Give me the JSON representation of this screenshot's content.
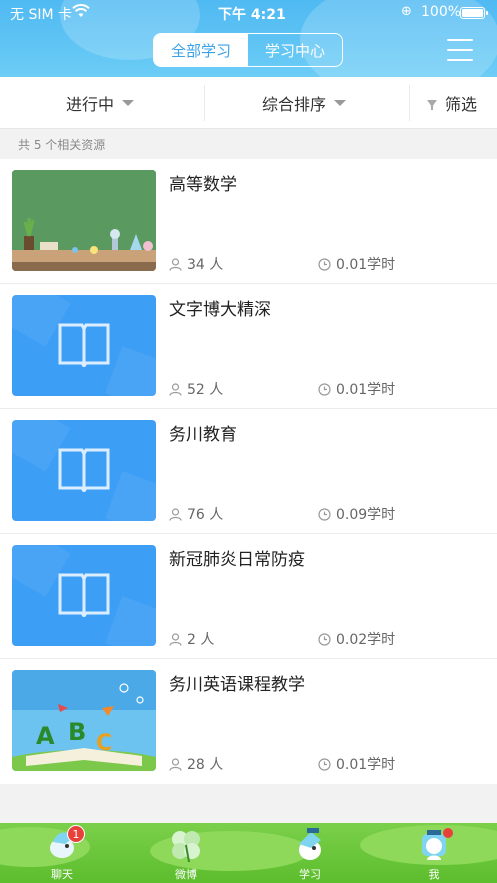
{
  "status_bar": {
    "carrier": "无 SIM 卡",
    "time": "下午 4:21",
    "battery": "100%"
  },
  "header": {
    "tabs": [
      {
        "label": "全部学习",
        "active": true
      },
      {
        "label": "学习中心",
        "active": false
      }
    ]
  },
  "filters": {
    "status": "进行中",
    "sort": "综合排序",
    "filter": "筛选"
  },
  "results_count": "共 5 个相关资源",
  "courses": [
    {
      "title": "高等数学",
      "people": "34 人",
      "hours": "0.01学时",
      "thumb": "science-classroom"
    },
    {
      "title": "文字博大精深",
      "people": "52 人",
      "hours": "0.01学时",
      "thumb": "book"
    },
    {
      "title": "务川教育",
      "people": "76 人",
      "hours": "0.09学时",
      "thumb": "book"
    },
    {
      "title": "新冠肺炎日常防疫",
      "people": "2 人",
      "hours": "0.02学时",
      "thumb": "book"
    },
    {
      "title": "务川英语课程教学",
      "people": "28 人",
      "hours": "0.01学时",
      "thumb": "abc-book"
    }
  ],
  "tabbar": [
    {
      "label": "聊天",
      "icon": "chat-bird-icon",
      "badge": "1"
    },
    {
      "label": "微博",
      "icon": "clover-icon"
    },
    {
      "label": "学习",
      "icon": "study-bird-icon",
      "active": true
    },
    {
      "label": "我",
      "icon": "profile-icon",
      "dot": true
    }
  ],
  "colors": {
    "header": "#4fb9f2",
    "accent": "#3aa3e8",
    "tabbar": "#5cbd2d",
    "badge": "#e8413a"
  }
}
